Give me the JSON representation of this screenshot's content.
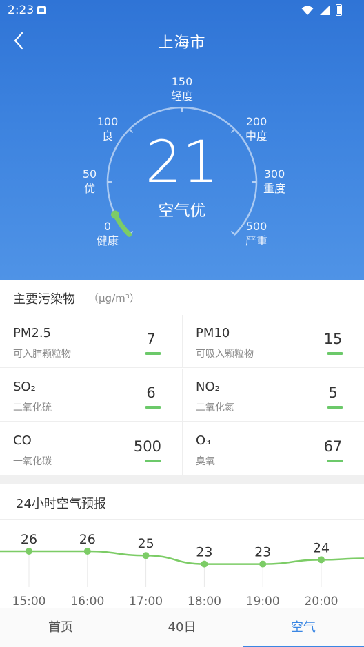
{
  "status_bar": {
    "time": "2:23"
  },
  "header": {
    "city": "上海市"
  },
  "gauge": {
    "aqi": "21",
    "level": "空气优",
    "scale": [
      {
        "value": "0",
        "label": "健康"
      },
      {
        "value": "50",
        "label": "优"
      },
      {
        "value": "100",
        "label": "良"
      },
      {
        "value": "150",
        "label": "轻度"
      },
      {
        "value": "200",
        "label": "中度"
      },
      {
        "value": "300",
        "label": "重度"
      },
      {
        "value": "500",
        "label": "严重"
      }
    ],
    "accent_color": "#7ccc66"
  },
  "pollutants": {
    "title": "主要污染物",
    "unit": "（μg/m³）",
    "items": [
      {
        "name": "PM2.5",
        "desc": "可入肺颗粒物",
        "value": "7"
      },
      {
        "name": "PM10",
        "desc": "可吸入颗粒物",
        "value": "15"
      },
      {
        "name": "SO₂",
        "desc": "二氧化硫",
        "value": "6"
      },
      {
        "name": "NO₂",
        "desc": "二氧化氮",
        "value": "5"
      },
      {
        "name": "CO",
        "desc": "一氧化碳",
        "value": "500"
      },
      {
        "name": "O₃",
        "desc": "臭氧",
        "value": "67"
      }
    ],
    "bar_color": "#6cc96a"
  },
  "forecast": {
    "title": "24小时空气预报",
    "line_color": "#7ccc66"
  },
  "chart_data": {
    "type": "line",
    "title": "24小时空气预报",
    "x": [
      "15:00",
      "16:00",
      "17:00",
      "18:00",
      "19:00",
      "20:00"
    ],
    "series": [
      {
        "values": [
          26,
          26,
          25,
          23,
          23,
          24
        ]
      }
    ],
    "xlabel": "",
    "ylabel": "",
    "grid": false
  },
  "tabs": {
    "home": "首页",
    "forty_day": "40日",
    "air": "空气"
  },
  "colors": {
    "primary": "#3a86e3",
    "hero_top": "#2f74d6",
    "hero_bottom": "#4f93e6"
  }
}
